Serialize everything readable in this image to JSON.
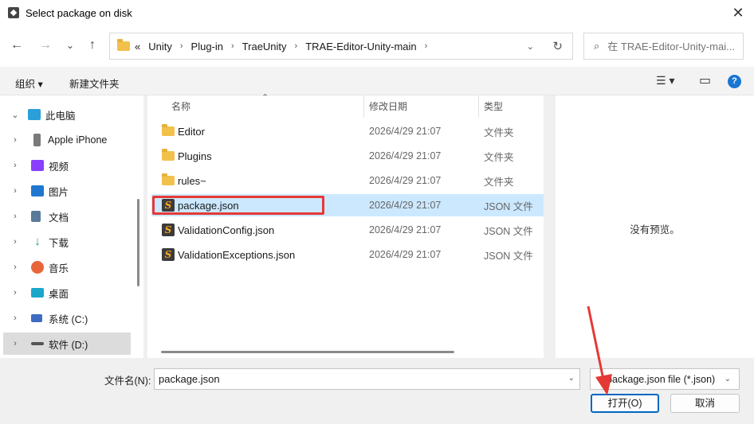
{
  "window": {
    "title": "Select package on disk",
    "close_glyph": "✕"
  },
  "nav": {
    "back_glyph": "←",
    "forward_glyph": "→",
    "recent_glyph": "⌄",
    "up_glyph": "↑",
    "overflow_glyph": "«",
    "breadcrumbs": [
      "Unity",
      "Plug-in",
      "TraeUnity",
      "TRAE-Editor-Unity-main"
    ],
    "crumb_sep": "›",
    "dropdown_glyph": "⌄",
    "refresh_glyph": "↻",
    "search_placeholder": "在 TRAE-Editor-Unity-mai...",
    "search_glyph": "⌕"
  },
  "commandbar": {
    "organize": "组织 ▾",
    "new_folder": "新建文件夹",
    "view_glyph": "☰ ▾",
    "pane_glyph": "▭",
    "help_glyph": "?"
  },
  "sidebar": {
    "items": [
      {
        "label": "此电脑",
        "icon": "computer-icon",
        "color": "#2b9fd9",
        "chev": "⌄"
      },
      {
        "label": "Apple iPhone",
        "icon": "phone-icon",
        "color": "#7a7a7a",
        "chev": "›"
      },
      {
        "label": "视频",
        "icon": "video-icon",
        "color": "#8a3ffc",
        "chev": "›"
      },
      {
        "label": "图片",
        "icon": "pictures-icon",
        "color": "#1f77d0",
        "chev": "›"
      },
      {
        "label": "文档",
        "icon": "documents-icon",
        "color": "#5b7a99",
        "chev": "›"
      },
      {
        "label": "下载",
        "icon": "download-icon",
        "color": "#1a9c5a",
        "chev": "›"
      },
      {
        "label": "音乐",
        "icon": "music-icon",
        "color": "#e8663a",
        "chev": "›"
      },
      {
        "label": "桌面",
        "icon": "desktop-icon",
        "color": "#1ba7c9",
        "chev": "›"
      },
      {
        "label": "系统 (C:)",
        "icon": "drive-icon",
        "color": "#3d6cc2",
        "chev": "›"
      },
      {
        "label": "软件 (D:)",
        "icon": "drive-icon",
        "color": "#555555",
        "chev": "›"
      }
    ]
  },
  "filelist": {
    "sort_glyph": "⌃",
    "columns": {
      "name": "名称",
      "date": "修改日期",
      "type": "类型"
    },
    "rows": [
      {
        "name": "Editor",
        "date": "2026/4/29 21:07",
        "type": "文件夹",
        "kind": "folder"
      },
      {
        "name": "Plugins",
        "date": "2026/4/29 21:07",
        "type": "文件夹",
        "kind": "folder"
      },
      {
        "name": "rules~",
        "date": "2026/4/29 21:07",
        "type": "文件夹",
        "kind": "folder"
      },
      {
        "name": "package.json",
        "date": "2026/4/29 21:07",
        "type": "JSON 文件",
        "kind": "json"
      },
      {
        "name": "ValidationConfig.json",
        "date": "2026/4/29 21:07",
        "type": "JSON 文件",
        "kind": "json"
      },
      {
        "name": "ValidationExceptions.json",
        "date": "2026/4/29 21:07",
        "type": "JSON 文件",
        "kind": "json"
      }
    ],
    "json_glyph": "S"
  },
  "preview": {
    "message": "没有预览。"
  },
  "footer": {
    "filename_label": "文件名(N):",
    "filename_value": "package.json",
    "filter_value": "package.json file (*.json)",
    "open_label": "打开(O)",
    "cancel_label": "取消",
    "dropdown_glyph": "⌄"
  },
  "colors": {
    "selection": "#cce8ff",
    "highlight_box": "#e53935",
    "accent": "#0067c0"
  }
}
